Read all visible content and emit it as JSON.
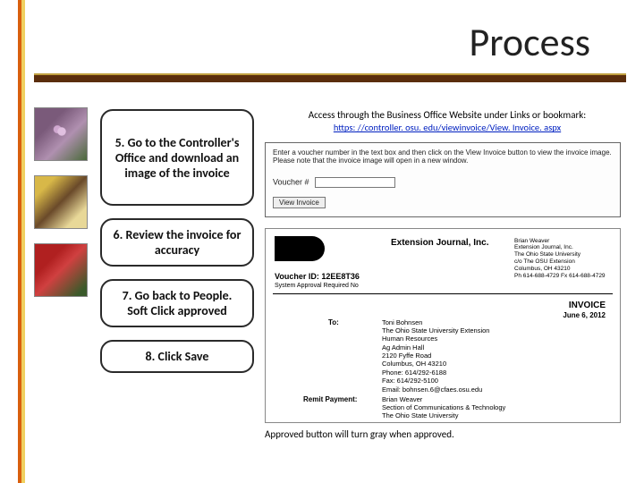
{
  "title": "Process",
  "steps": {
    "s5": "5. Go to the Controller's Office and download an image of the invoice",
    "s6": "6. Review the invoice for accuracy",
    "s7": "7. Go back to People. Soft Click approved",
    "s8": "8. Click Save"
  },
  "access": {
    "intro": "Access through the Business Office Website under Links or bookmark:",
    "url": "https: //controller. osu. edu/viewinvoice/View. Invoice. aspx"
  },
  "panel1": {
    "instr": "Enter a voucher number in the text box and then click on the View Invoice button to view the invoice image. Please note that the invoice image will open in a new window.",
    "voucher_label": "Voucher #",
    "button": "View Invoice"
  },
  "panel2": {
    "journal": "Extension Journal, Inc.",
    "addr": "Brian Weaver\nExtension Journal, Inc.\nThe Ohio State University\nc/o The OSU Extension\nColumbus, OH 43210\nPh 614-688-4729  Fx 614-688-4729",
    "voucher_id": "Voucher ID: 12EE8T36",
    "sys": "System Approval Required    No",
    "inv_title": "INVOICE",
    "inv_date": "June 6, 2012",
    "to_label": "To:",
    "to_addr": "Toni Bohnsen\nThe Ohio State University Extension\nHuman Resources\nAg Admin Hall\n2120 Fyffe Road\nColumbus, OH 43210\nPhone: 614/292-6188\nFax: 614/292-5100\nEmail: bohnsen.6@cfaes.osu.edu",
    "remit_label": "Remit Payment:",
    "remit_addr": "Brian Weaver\nSection of Communications & Technology\nThe Ohio State University"
  },
  "footer": "Approved button will turn gray when approved."
}
